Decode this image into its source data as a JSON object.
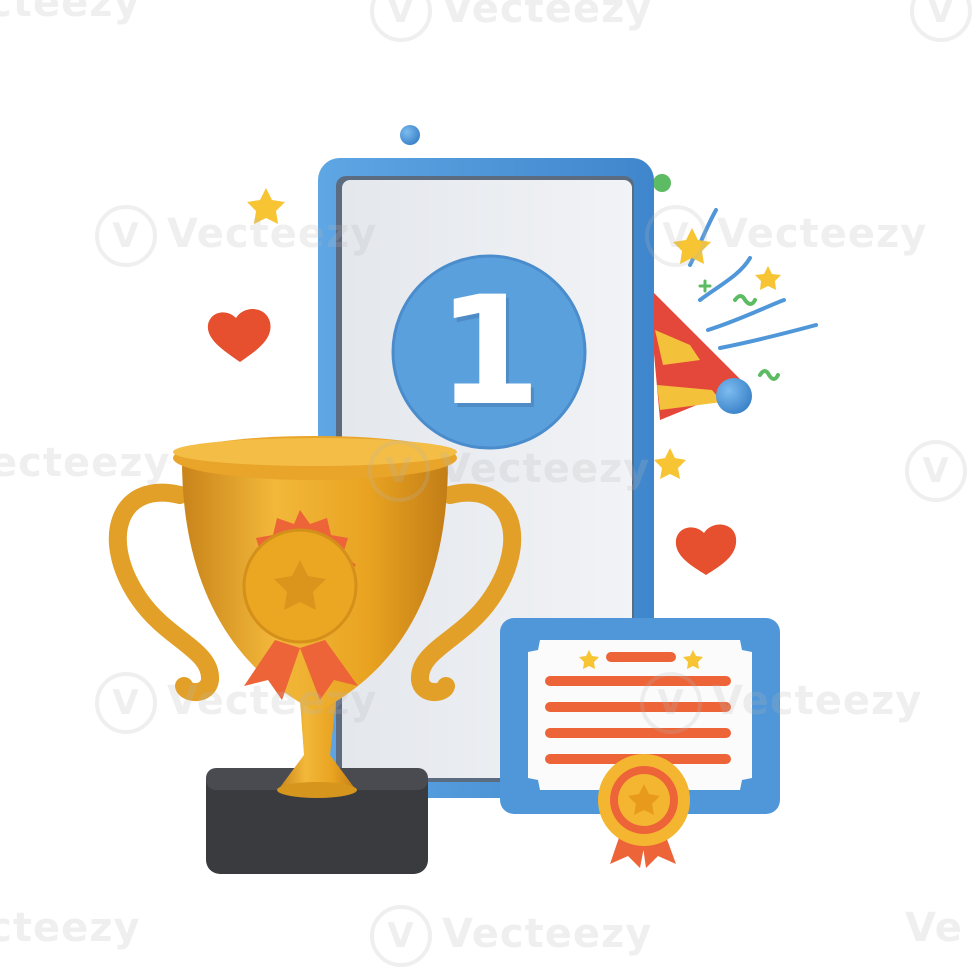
{
  "phone_screen": {
    "rank_number": "1"
  },
  "watermark": {
    "brand": "Vecteezy",
    "partial_left": "ecteezy",
    "partial_right": "Ve"
  },
  "colors": {
    "phone_frame": "#4f97d8",
    "phone_screen": "#eceff3",
    "badge_blue": "#5aa0dd",
    "trophy_gold": "#e7a723",
    "ribbon_orange": "#ec6438",
    "base_dark": "#3a3b3f",
    "heart_red": "#e6502e",
    "star_yellow": "#f7c534"
  },
  "icons": [
    "trophy-icon",
    "smartphone-icon",
    "rank-badge-icon",
    "certificate-icon",
    "rosette-icon",
    "heart-icon",
    "star-icon",
    "party-popper-icon",
    "confetti-icon"
  ]
}
